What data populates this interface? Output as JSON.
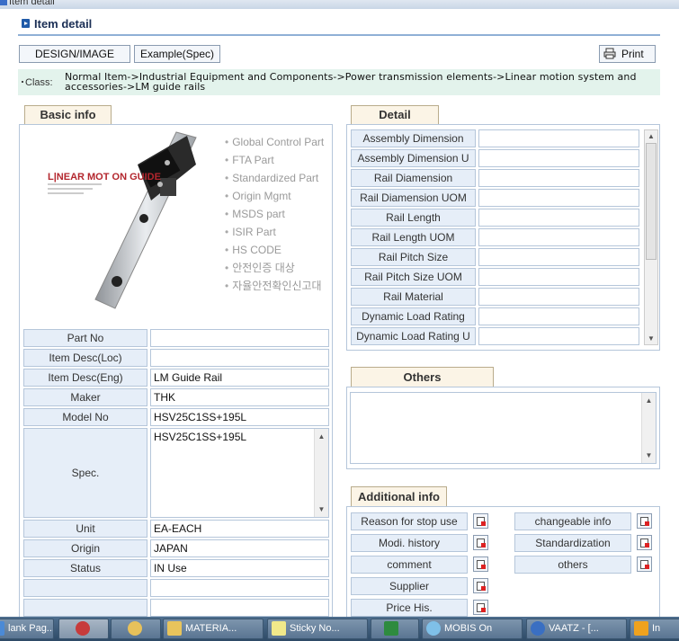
{
  "window": {
    "title": "Item detail"
  },
  "header": {
    "title": "Item detail"
  },
  "toolbar": {
    "design_label": "DESIGN/IMAGE",
    "example_label": "Example(Spec)",
    "print_label": "Print"
  },
  "classification": {
    "label": "Class:",
    "path": "Normal Item->Industrial Equipment and Components->Power transmission elements->Linear motion system and accessories->LM guide rails"
  },
  "basic_info": {
    "tab_label": "Basic info",
    "product_image": {
      "brand_text": "LINEAR MOTION GUIDE"
    },
    "flags": [
      "Global Control Part",
      "FTA Part",
      "Standardized Part",
      "Origin Mgmt",
      "MSDS part",
      "ISIR Part",
      "HS CODE",
      "안전인증 대상",
      "자율안전확인신고대"
    ],
    "fields": [
      {
        "label": "Part No",
        "value": ""
      },
      {
        "label": "Item Desc(Loc)",
        "value": ""
      },
      {
        "label": "Item Desc(Eng)",
        "value": "LM Guide Rail"
      },
      {
        "label": "Maker",
        "value": "THK"
      },
      {
        "label": "Model No",
        "value": "HSV25C1SS+195L"
      }
    ],
    "spec": {
      "label": "Spec.",
      "value": "HSV25C1SS+195L"
    },
    "fields2": [
      {
        "label": "Unit",
        "value": "EA-EACH"
      },
      {
        "label": "Origin",
        "value": "JAPAN"
      },
      {
        "label": "Status",
        "value": "IN Use"
      },
      {
        "label": "",
        "value": ""
      },
      {
        "label": "",
        "value": ""
      }
    ]
  },
  "detail": {
    "tab_label": "Detail",
    "rows": [
      {
        "label": "Assembly Dimension",
        "value": ""
      },
      {
        "label": "Assembly Dimension U",
        "value": ""
      },
      {
        "label": "Rail Diamension",
        "value": ""
      },
      {
        "label": "Rail Diamension UOM",
        "value": ""
      },
      {
        "label": "Rail Length",
        "value": ""
      },
      {
        "label": "Rail Length UOM",
        "value": ""
      },
      {
        "label": "Rail Pitch Size",
        "value": ""
      },
      {
        "label": "Rail Pitch Size UOM",
        "value": ""
      },
      {
        "label": "Rail Material",
        "value": ""
      },
      {
        "label": "Dynamic Load Rating",
        "value": ""
      },
      {
        "label": "Dynamic Load Rating U",
        "value": ""
      }
    ]
  },
  "others": {
    "tab_label": "Others",
    "text": ""
  },
  "additional_info": {
    "tab_label": "Additional info",
    "left": [
      "Reason for stop use",
      "Modi. history",
      "comment",
      "Supplier",
      "Price His."
    ],
    "right": [
      "changeable info",
      "Standardization",
      "others"
    ]
  },
  "taskbar": {
    "items": [
      {
        "label": "lank Pag...",
        "icon": "ie-icon"
      },
      {
        "label": "",
        "icon": "snipping-icon"
      },
      {
        "label": "",
        "icon": "paint-icon"
      },
      {
        "label": "MATERIA...",
        "icon": "folder-icon"
      },
      {
        "label": "Sticky No...",
        "icon": "sticky-notes-icon"
      },
      {
        "label": "",
        "icon": "excel-icon"
      },
      {
        "label": "MOBIS On",
        "icon": "chat-icon"
      },
      {
        "label": "VAATZ - [...",
        "icon": "globe-icon"
      },
      {
        "label": "In",
        "icon": "outlook-icon"
      }
    ]
  },
  "colors": {
    "label_bg": "#e6eef8",
    "border": "#b5c6da",
    "tab_bg": "#fbf4e6",
    "class_bg": "#e3f3ec",
    "taskbar": "#3e5c7a"
  }
}
